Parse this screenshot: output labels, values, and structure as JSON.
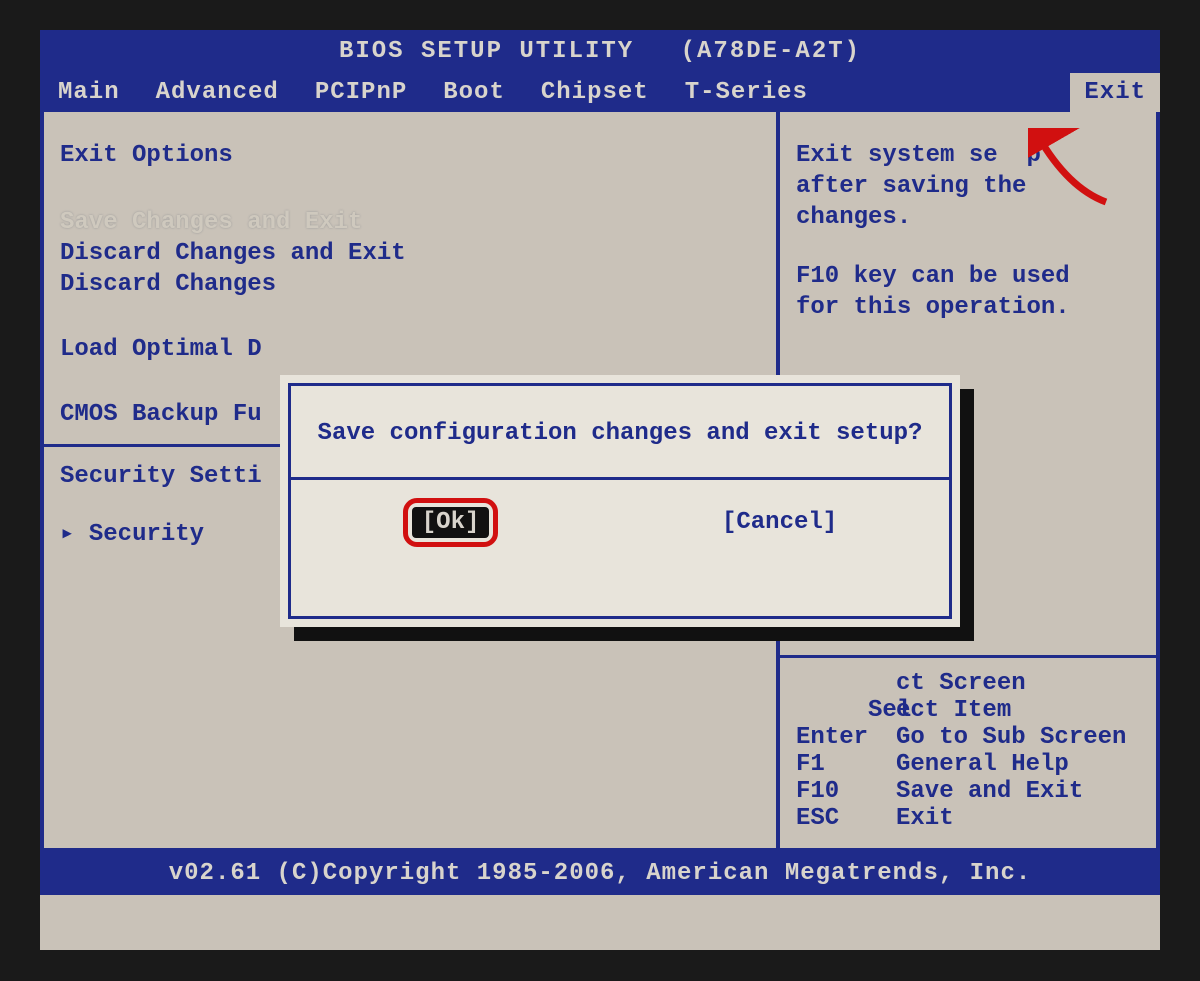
{
  "header": {
    "title": "BIOS SETUP UTILITY",
    "board": "(A78DE-A2T)"
  },
  "tabs": [
    "Main",
    "Advanced",
    "PCIPnP",
    "Boot",
    "Chipset",
    "T-Series",
    "Exit"
  ],
  "active_tab": "Exit",
  "main": {
    "heading": "Exit Options",
    "items": [
      "Save Changes and Exit",
      "Discard Changes and Exit",
      "Discard Changes"
    ],
    "item_loadopt": "Load Optimal D",
    "item_cmos": "CMOS Backup Fu",
    "security_heading": "Security Setti",
    "security_item": "Security"
  },
  "side": {
    "desc1": "Exit system se",
    "desc1b": "p",
    "desc2": "after saving the",
    "desc3": "changes.",
    "desc4": "F10 key can be used",
    "desc5": "for this operation."
  },
  "help": [
    {
      "key": "",
      "label": "ct Screen"
    },
    {
      "key": "↑↓",
      "label": "Select Item",
      "label_cut": "ect Item"
    },
    {
      "key": "Enter",
      "label": "Go to Sub Screen"
    },
    {
      "key": "F1",
      "label": "General Help"
    },
    {
      "key": "F10",
      "label": "Save and Exit"
    },
    {
      "key": "ESC",
      "label": "Exit"
    }
  ],
  "dialog": {
    "message": "Save configuration changes and exit setup?",
    "ok": "[Ok]",
    "cancel": "[Cancel]"
  },
  "footer": "v02.61 (C)Copyright 1985-2006, American Megatrends, Inc."
}
